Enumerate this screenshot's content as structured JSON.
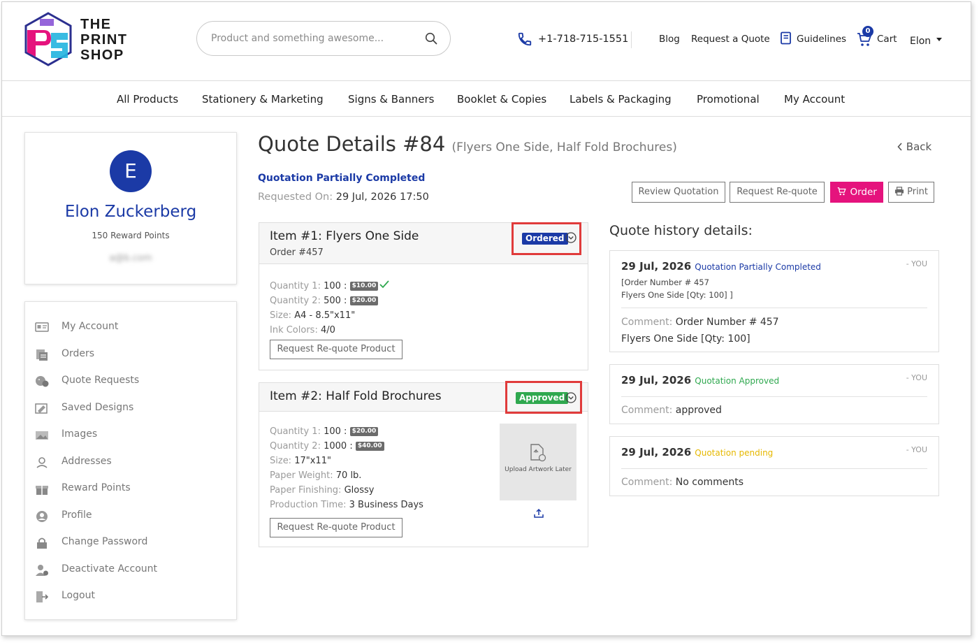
{
  "header": {
    "logo_line1": "THE",
    "logo_line2": "PRINT",
    "logo_line3": "SHOP",
    "search_placeholder": "Product and something awesome...",
    "phone": "+1-718-715-1551",
    "links": {
      "blog": "Blog",
      "request_quote": "Request a Quote",
      "guidelines": "Guidelines",
      "cart": "Cart",
      "cart_count": "0",
      "user": "Elon"
    }
  },
  "nav": [
    "All Products",
    "Stationery & Marketing",
    "Signs & Banners",
    "Booklet & Copies",
    "Labels & Packaging",
    "Promotional",
    "My Account"
  ],
  "profile": {
    "initial": "E",
    "name": "Elon Zuckerberg",
    "points": "150 Reward Points",
    "email_blurred": "a@b.com"
  },
  "sidebar": [
    {
      "label": "My Account",
      "icon": "id-card-icon"
    },
    {
      "label": "Orders",
      "icon": "orders-icon"
    },
    {
      "label": "Quote Requests",
      "icon": "quote-icon"
    },
    {
      "label": "Saved Designs",
      "icon": "design-icon"
    },
    {
      "label": "Images",
      "icon": "image-icon"
    },
    {
      "label": "Addresses",
      "icon": "address-icon"
    },
    {
      "label": "Reward Points",
      "icon": "gift-icon"
    },
    {
      "label": "Profile",
      "icon": "profile-icon"
    },
    {
      "label": "Change Password",
      "icon": "lock-icon"
    },
    {
      "label": "Deactivate Account",
      "icon": "deactivate-icon"
    },
    {
      "label": "Logout",
      "icon": "logout-icon"
    }
  ],
  "quote": {
    "title": "Quote Details #84",
    "subtitle": "(Flyers One Side, Half Fold Brochures)",
    "back": "Back",
    "status": "Quotation Partially Completed",
    "requested_label": "Requested On:",
    "requested_value": "29 Jul, 2026 17:50",
    "buttons": {
      "review": "Review Quotation",
      "requote": "Request Re-quote",
      "order": "Order",
      "print": "Print"
    }
  },
  "items": [
    {
      "title": "Item #1: Flyers One Side",
      "order": "Order #457",
      "badge": "Ordered",
      "q1_label": "Quantity 1:",
      "q1_value": "100 :",
      "q1_price": "$10.00",
      "q2_label": "Quantity 2:",
      "q2_value": "500 :",
      "q2_price": "$20.00",
      "size_label": "Size:",
      "size_value": "A4 - 8.5\"x11\"",
      "ink_label": "Ink Colors:",
      "ink_value": "4/0",
      "button": "Request Re-quote Product"
    },
    {
      "title": "Item #2: Half Fold Brochures",
      "badge": "Approved",
      "q1_label": "Quantity 1:",
      "q1_value": "100 :",
      "q1_price": "$20.00",
      "q2_label": "Quantity 2:",
      "q2_value": "1000 :",
      "q2_price": "$40.00",
      "size_label": "Size:",
      "size_value": "17\"x11\"",
      "weight_label": "Paper Weight:",
      "weight_value": "70 lb.",
      "finish_label": "Paper Finishing:",
      "finish_value": "Glossy",
      "time_label": "Production Time:",
      "time_value": "3 Business Days",
      "upload_text": "Upload Artwork Later",
      "button": "Request Re-quote Product"
    }
  ],
  "history": {
    "title": "Quote history details:",
    "entries": [
      {
        "date": "29 Jul, 2026",
        "status": "Quotation Partially Completed",
        "by": "- YOU",
        "note1": "[Order Number # 457",
        "note2": "Flyers One Side [Qty: 100] ]",
        "comment_label": "Comment:",
        "comment": "Order Number # 457",
        "comment2": "Flyers One Side [Qty: 100]"
      },
      {
        "date": "29 Jul, 2026",
        "status": "Quotation Approved",
        "by": "- YOU",
        "comment_label": "Comment:",
        "comment": "approved"
      },
      {
        "date": "29 Jul, 2026",
        "status": "Quotation pending",
        "by": "- YOU",
        "comment_label": "Comment:",
        "comment": "No comments"
      }
    ]
  },
  "colors": {
    "brand_blue": "#1b3aa6",
    "order_pink": "#e5137d",
    "approved_green": "#2fa84f",
    "pending_yellow": "#e6b800",
    "highlight_red": "#e03b3b"
  }
}
